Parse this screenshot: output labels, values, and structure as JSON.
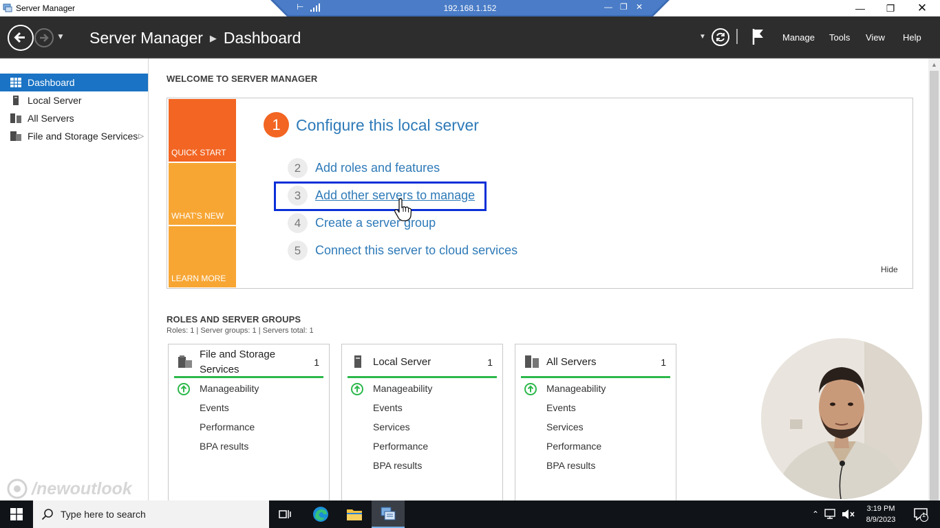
{
  "window": {
    "title": "Server Manager",
    "rdp_host": "192.168.1.152"
  },
  "header": {
    "title": "Server Manager",
    "page": "Dashboard",
    "menu": [
      "Manage",
      "Tools",
      "View",
      "Help"
    ]
  },
  "sidebar": {
    "items": [
      {
        "label": "Dashboard",
        "icon": "dashboard-icon",
        "active": true
      },
      {
        "label": "Local Server",
        "icon": "server-icon"
      },
      {
        "label": "All Servers",
        "icon": "servers-icon"
      },
      {
        "label": "File and Storage Services",
        "icon": "storage-icon"
      }
    ]
  },
  "welcome": {
    "title": "WELCOME TO SERVER MANAGER",
    "tiles": [
      "QUICK START",
      "WHAT'S NEW",
      "LEARN MORE"
    ],
    "step1": {
      "num": "1",
      "label": "Configure this local server"
    },
    "steps": [
      {
        "num": "2",
        "label": "Add roles and features"
      },
      {
        "num": "3",
        "label": "Add other servers to manage"
      },
      {
        "num": "4",
        "label": "Create a server group"
      },
      {
        "num": "5",
        "label": "Connect this server to cloud services"
      }
    ],
    "hide": "Hide"
  },
  "roles": {
    "title": "ROLES AND SERVER GROUPS",
    "summary": "Roles: 1   |   Server groups: 1   |   Servers total: 1",
    "cards": [
      {
        "title_line1": "File and Storage",
        "title_line2": "Services",
        "count": "1",
        "rows": [
          "Manageability",
          "Events",
          "Performance",
          "BPA results"
        ]
      },
      {
        "title_line1": "Local Server",
        "title_line2": "",
        "count": "1",
        "rows": [
          "Manageability",
          "Events",
          "Services",
          "Performance",
          "BPA results"
        ]
      },
      {
        "title_line1": "All Servers",
        "title_line2": "",
        "count": "1",
        "rows": [
          "Manageability",
          "Events",
          "Services",
          "Performance",
          "BPA results"
        ]
      }
    ]
  },
  "watermark": "/newoutlook",
  "taskbar": {
    "search_placeholder": "Type here to search",
    "time": "3:19 PM",
    "date": "8/9/2023",
    "notification_count": "1"
  },
  "colors": {
    "accent_blue": "#1a73c4",
    "link_blue": "#2e7ab8",
    "quick_start_orange": "#f26522",
    "tile_amber": "#f7a634",
    "status_green": "#2bb84a",
    "highlight_box": "#0a2fd8"
  }
}
